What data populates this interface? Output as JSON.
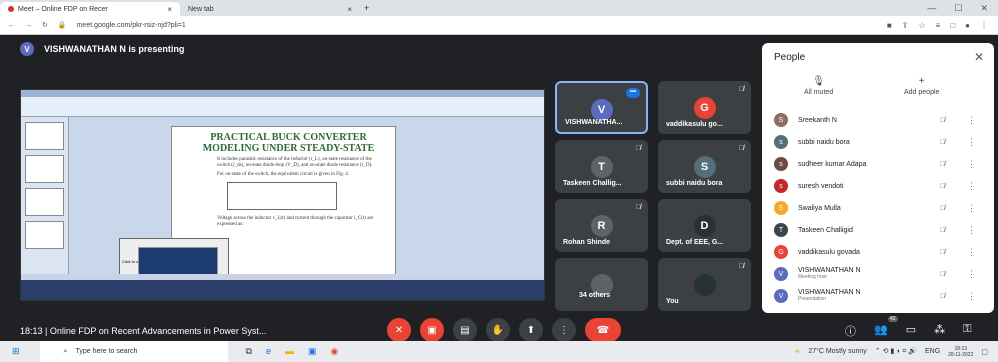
{
  "browser": {
    "tabs": [
      {
        "title": "Meet – Online FDP on Recer",
        "close": "×"
      },
      {
        "title": "New tab",
        "close": "×"
      }
    ],
    "new_tab": "+",
    "url": "meet.google.com/pkr-rsiz-njd?pli=1"
  },
  "meet": {
    "presenter_initial": "V",
    "presenter_text": "VISHWANATHAN N is presenting",
    "slide": {
      "title": "PRACTICAL BUCK CONVERTER MODELING UNDER STEADY-STATE",
      "body1": "It includes parasitic resistance of the inductor (r_L), on-state resistance of the switch (r_ds), on-state diode drop (V_D), and on-state diode resistance (r_D).",
      "body2": "For on-state of the switch, the equivalent circuit is given in Fig. 4.",
      "body3": "Voltage across the inductor v_L(t) and current through the capacitor i_C(t) are expressed as:",
      "popup_label": "Click to add"
    },
    "tiles": [
      {
        "name": "VISHWANATHA...",
        "initial": "V",
        "color": "#5c6bc0"
      },
      {
        "name": "vaddikasulu go...",
        "initial": "G",
        "color": "#ea4335"
      },
      {
        "name": "Taskeen Challig...",
        "initial": "T",
        "color": "#5f6368"
      },
      {
        "name": "subbi naidu bora",
        "initial": "S",
        "color": "#546e7a"
      },
      {
        "name": "Rohan Shinde",
        "initial": "R",
        "color": "#5f6368"
      },
      {
        "name": "Dept. of EEE, G...",
        "initial": "D",
        "color": "#3c4043"
      },
      {
        "name": "34 others",
        "initial": "",
        "color": "#5f6368"
      },
      {
        "name": "You",
        "initial": "",
        "color": "#3c4043"
      }
    ],
    "time": "18:13",
    "meeting_title": "Online FDP on Recent Advancements in Power Syst...",
    "people_count": "42"
  },
  "people": {
    "title": "People",
    "all_muted": "All muted",
    "add_people": "Add people",
    "list": [
      {
        "name": "Sreekanth N",
        "sub": "",
        "initial": "S",
        "color": "#8d6e63"
      },
      {
        "name": "subbi naidu bora",
        "sub": "",
        "initial": "s",
        "color": "#546e7a"
      },
      {
        "name": "sudheer kumar Adapa",
        "sub": "",
        "initial": "s",
        "color": "#6d4c41"
      },
      {
        "name": "suresh vendoti",
        "sub": "",
        "initial": "s",
        "color": "#c62828"
      },
      {
        "name": "Swaliya Mulla",
        "sub": "",
        "initial": "S",
        "color": "#f9a825"
      },
      {
        "name": "Taskeen Challigid",
        "sub": "",
        "initial": "T",
        "color": "#37474f"
      },
      {
        "name": "vaddikasulu govada",
        "sub": "",
        "initial": "G",
        "color": "#ea4335"
      },
      {
        "name": "VISHWANATHAN N",
        "sub": "Meeting host",
        "initial": "V",
        "color": "#5c6bc0"
      },
      {
        "name": "VISHWANATHAN N",
        "sub": "Presentation",
        "initial": "V",
        "color": "#5c6bc0"
      }
    ]
  },
  "taskbar": {
    "search_placeholder": "Type here to search",
    "weather": "27°C Mostly sunny",
    "lang": "ENG",
    "time": "18:13",
    "date": "28-11-2022"
  }
}
